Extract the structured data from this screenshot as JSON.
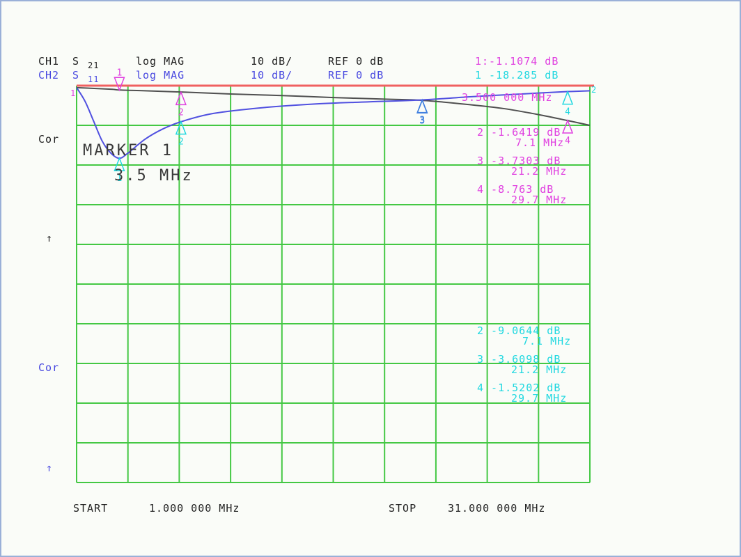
{
  "header": {
    "ch1_label": "CH1",
    "ch1_param": "S",
    "ch1_param_sub": "21",
    "ch1_format": "log MAG",
    "ch1_scale": "10 dB/",
    "ch1_ref": "REF 0 dB",
    "ch2_label": "CH2",
    "ch2_param": "S",
    "ch2_param_sub": "11",
    "ch2_format": "log MAG",
    "ch2_scale": "10 dB/",
    "ch2_ref": "REF 0 dB"
  },
  "side": {
    "cor_top": "Cor",
    "arrow_top": "↑",
    "cor_bottom": "Cor",
    "arrow_bottom": "↑"
  },
  "active_marker": {
    "title": "MARKER 1",
    "freq": "3.5 MHz"
  },
  "ch1_markers": {
    "m1_value": "1:-1.1074 dB",
    "m1_freq": "3.500 000 MHz",
    "m2_value": "2 -1.6419 dB",
    "m2_freq": "7.1 MHz",
    "m3_value": "3 -3.7303 dB",
    "m3_freq": "21.2 MHz",
    "m4_value": "4 -8.763 dB",
    "m4_freq": "29.7 MHz"
  },
  "ch2_markers": {
    "m1_value": "1 -18.285 dB",
    "m2_value": "2 -9.0644 dB",
    "m2_freq": "7.1 MHz",
    "m3_value": "3 -3.6098 dB",
    "m3_freq": "21.2 MHz",
    "m4_value": "4 -1.5202 dB",
    "m4_freq": "29.7 MHz"
  },
  "footer": {
    "start_label": "START",
    "start_value": "1.000 000 MHz",
    "stop_label": "STOP",
    "stop_value": "31.000 000 MHz"
  },
  "colors": {
    "grid": "#44c844",
    "ch1_trace": "#505050",
    "ch2_trace": "#5050e0",
    "ref_line": "#f06060",
    "ch1_marker": "#e040e0",
    "ch2_marker": "#20d8e0",
    "marker3": "#4080e0"
  },
  "chart_data": {
    "type": "line",
    "x_unit": "MHz",
    "xlim": [
      1,
      31
    ],
    "ylim": [
      -100,
      0
    ],
    "grid": true,
    "y_divisions": 10,
    "x_divisions": 10,
    "series": [
      {
        "name": "CH1 S21 log MAG",
        "color": "#505050",
        "x": [
          1,
          3,
          3.5,
          5,
          7.1,
          10,
          13,
          16,
          19,
          21.2,
          24,
          26,
          28,
          29.7,
          31
        ],
        "y": [
          -0.5,
          -0.9,
          -1.1,
          -1.3,
          -1.6,
          -2.1,
          -2.5,
          -3.0,
          -3.4,
          -3.7,
          -4.8,
          -5.8,
          -7.3,
          -8.8,
          -10.0
        ]
      },
      {
        "name": "CH2 S11 log MAG",
        "color": "#5050e0",
        "x": [
          1,
          1.5,
          2,
          2.5,
          3,
          3.5,
          4,
          5,
          6,
          7.1,
          9,
          12,
          15,
          18,
          21.2,
          24,
          27,
          29.7,
          31
        ],
        "y": [
          -0.5,
          -4,
          -9,
          -14,
          -17,
          -18.3,
          -17,
          -13.5,
          -11,
          -9.1,
          -7,
          -5.5,
          -4.6,
          -4.1,
          -3.6,
          -2.8,
          -2.1,
          -1.5,
          -1.3
        ]
      }
    ],
    "markers": {
      "ch1": [
        {
          "n": "1",
          "x": 3.5,
          "y": -1.1074
        },
        {
          "n": "2",
          "x": 7.1,
          "y": -1.6419
        },
        {
          "n": "3",
          "x": 21.2,
          "y": -3.7303
        },
        {
          "n": "4",
          "x": 29.7,
          "y": -8.763
        }
      ],
      "ch2": [
        {
          "n": "1",
          "x": 3.5,
          "y": -18.285
        },
        {
          "n": "2",
          "x": 7.1,
          "y": -9.0644
        },
        {
          "n": "3",
          "x": 21.2,
          "y": -3.6098
        },
        {
          "n": "4",
          "x": 29.7,
          "y": -1.5202
        }
      ]
    }
  }
}
